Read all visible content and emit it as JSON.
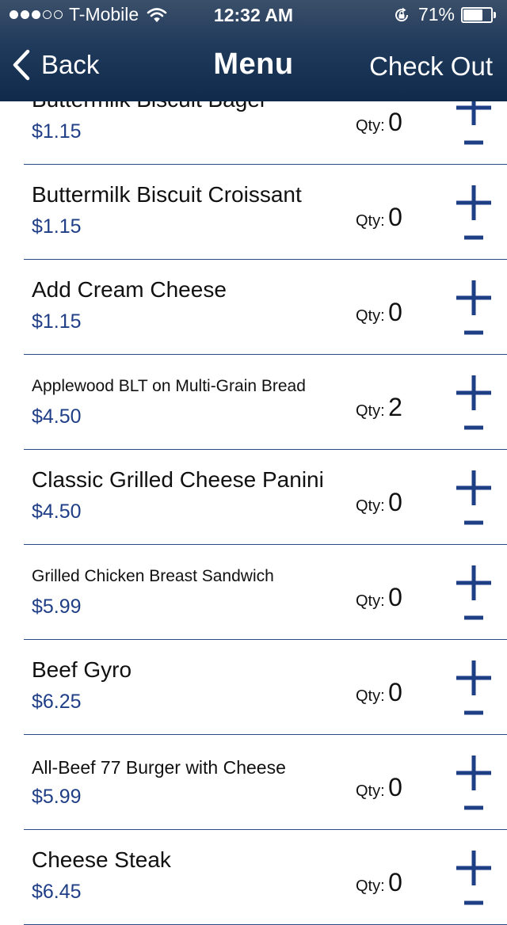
{
  "status_bar": {
    "carrier": "T-Mobile",
    "signal_bars_filled": 3,
    "signal_bars_total": 5,
    "time": "12:32 AM",
    "battery_percent": "71%",
    "battery_level": 0.71
  },
  "nav": {
    "back_label": "Back",
    "title": "Menu",
    "checkout_label": "Check Out"
  },
  "qty_label": "Qty:",
  "items": [
    {
      "name": "Buttermilk Biscuit Bagel",
      "price": "$1.15",
      "qty": "0"
    },
    {
      "name": "Buttermilk Biscuit Croissant",
      "price": "$1.15",
      "qty": "0"
    },
    {
      "name": "Add Cream Cheese",
      "price": "$1.15",
      "qty": "0"
    },
    {
      "name": "Applewood BLT on Multi-Grain Bread",
      "price": "$4.50",
      "qty": "2"
    },
    {
      "name": "Classic Grilled Cheese Panini",
      "price": "$4.50",
      "qty": "0"
    },
    {
      "name": "Grilled Chicken Breast Sandwich",
      "price": "$5.99",
      "qty": "0"
    },
    {
      "name": "Beef Gyro",
      "price": "$6.25",
      "qty": "0"
    },
    {
      "name": "All-Beef 77 Burger with Cheese",
      "price": "$5.99",
      "qty": "0"
    },
    {
      "name": "Cheese Steak",
      "price": "$6.45",
      "qty": "0"
    }
  ],
  "colors": {
    "accent": "#1e3e86",
    "nav_bar": "#203a5c",
    "divider": "#2a4a88"
  }
}
